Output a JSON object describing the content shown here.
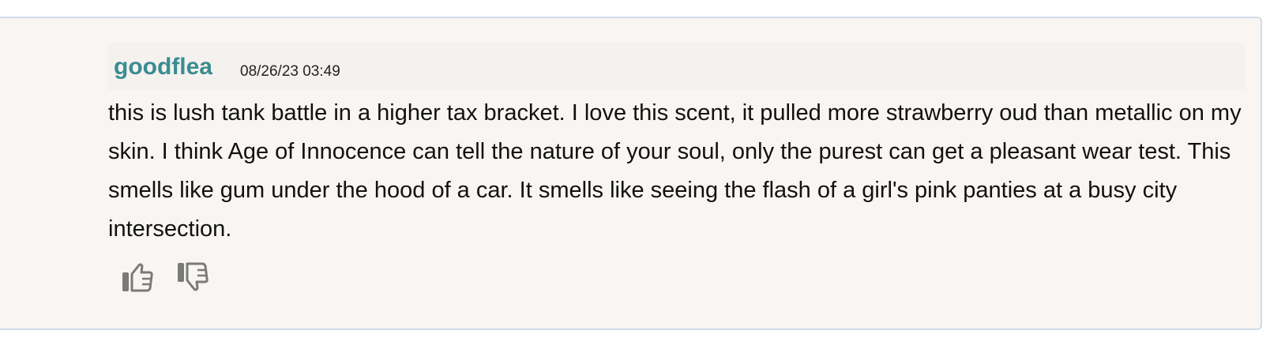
{
  "review": {
    "username": "goodflea",
    "timestamp": "08/26/23 03:49",
    "text": "this is lush tank battle in a higher tax bracket. I love this scent, it pulled more strawberry oud than metallic on my skin. I think Age of Innocence can tell the nature of your soul, only the purest can get a pleasant wear test. This smells like gum under the hood of a car. It smells like seeing the flash of a girl's pink panties at a busy city intersection."
  },
  "icons": {
    "upvote": "thumbs-up-icon",
    "downvote": "thumbs-down-icon"
  },
  "colors": {
    "username": "#3a8d91",
    "card_background": "#f8f5f3",
    "card_border": "#cfdde8",
    "icon": "#7a7a7a"
  }
}
